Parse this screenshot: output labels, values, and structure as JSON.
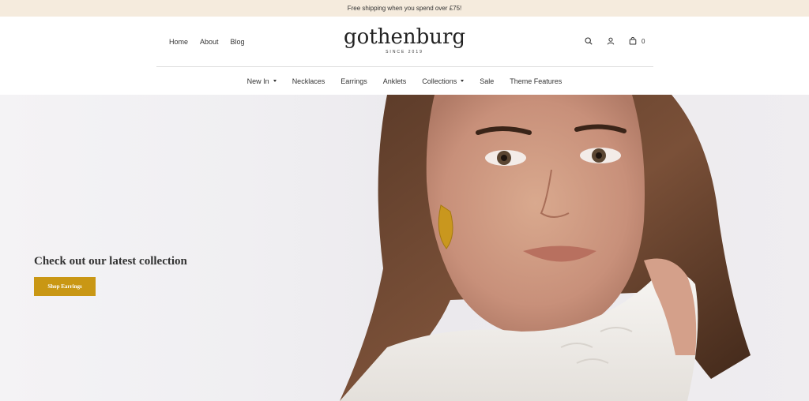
{
  "announcement": "Free shipping when you spend over £75!",
  "header": {
    "left_nav": [
      "Home",
      "About",
      "Blog"
    ],
    "logo": {
      "word": "gothenburg",
      "since": "SINCE 2019"
    },
    "icons": [
      "search-icon",
      "user-icon",
      "cart-icon"
    ],
    "cart_count": "0"
  },
  "main_nav": {
    "items": [
      {
        "label": "New In",
        "dropdown": true
      },
      {
        "label": "Necklaces",
        "dropdown": false
      },
      {
        "label": "Earrings",
        "dropdown": false
      },
      {
        "label": "Anklets",
        "dropdown": false
      },
      {
        "label": "Collections",
        "dropdown": true
      },
      {
        "label": "Sale",
        "dropdown": false
      },
      {
        "label": "Theme Features",
        "dropdown": false
      }
    ]
  },
  "hero": {
    "title": "Check out our latest collection",
    "button": "Shop Earrings"
  },
  "colors": {
    "announcement_bg": "#f5ebdd",
    "button_bg": "#c99714",
    "text": "#333333"
  }
}
